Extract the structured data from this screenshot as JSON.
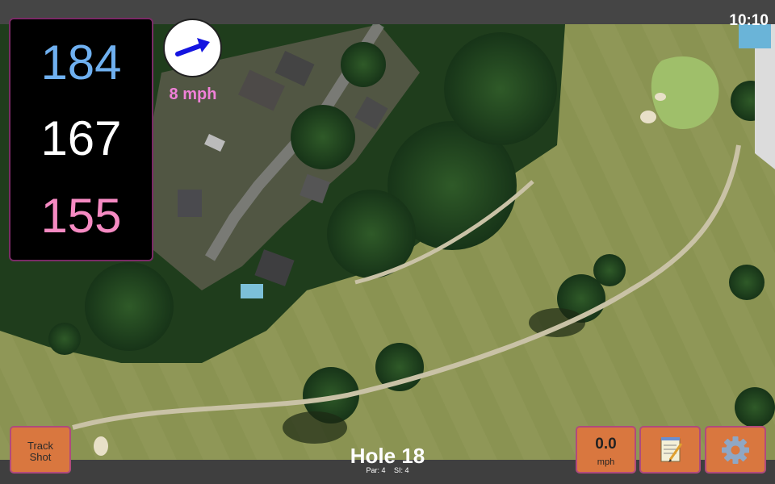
{
  "status": {
    "time": "10:10"
  },
  "distances": {
    "back": "184",
    "middle": "167",
    "front": "155"
  },
  "wind": {
    "speed_text": "8 mph",
    "arrow_icon": "wind-arrow-icon"
  },
  "hole": {
    "title": "Hole 18",
    "par_text": "Par: 4",
    "si_text": "SI: 4"
  },
  "buttons": {
    "track_shot_line1": "Track",
    "track_shot_line2": "Shot",
    "speed_value": "0.0",
    "speed_unit": "mph",
    "notes_icon": "notepad-icon",
    "settings_icon": "gear-icon"
  },
  "colors": {
    "back_distance": "#6fb0f0",
    "middle_distance": "#ffffff",
    "front_distance": "#f58ac2",
    "wind_text": "#f080d8",
    "button_fill": "#d9773f",
    "button_border": "#b04a7c"
  }
}
